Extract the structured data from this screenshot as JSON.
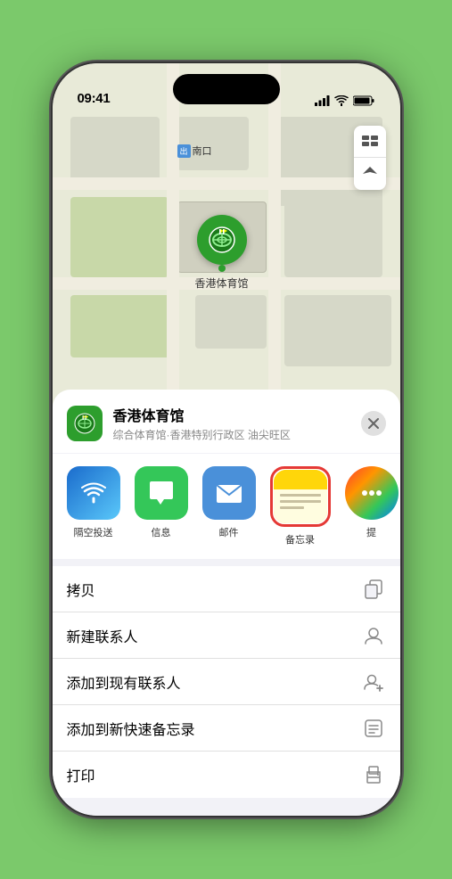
{
  "statusBar": {
    "time": "09:41",
    "location_icon": "arrow-up-right"
  },
  "map": {
    "label_nankou": "南口",
    "label_nankou_prefix": "出",
    "stadium_name": "香港体育馆",
    "pin_label": "香港体育馆"
  },
  "sheet": {
    "venue_name": "香港体育馆",
    "venue_sub": "综合体育馆·香港特别行政区 油尖旺区",
    "close_label": "×"
  },
  "shareRow": {
    "items": [
      {
        "id": "airdrop",
        "label": "隔空投送",
        "type": "airdrop"
      },
      {
        "id": "message",
        "label": "信息",
        "type": "message"
      },
      {
        "id": "mail",
        "label": "邮件",
        "type": "mail"
      },
      {
        "id": "notes",
        "label": "备忘录",
        "type": "notes",
        "selected": true
      },
      {
        "id": "more",
        "label": "提",
        "type": "more"
      }
    ]
  },
  "actionList": {
    "items": [
      {
        "id": "copy",
        "label": "拷贝",
        "icon": "copy"
      },
      {
        "id": "new-contact",
        "label": "新建联系人",
        "icon": "person"
      },
      {
        "id": "add-existing",
        "label": "添加到现有联系人",
        "icon": "person-add"
      },
      {
        "id": "add-notes",
        "label": "添加到新快速备忘录",
        "icon": "notes"
      },
      {
        "id": "print",
        "label": "打印",
        "icon": "print"
      }
    ]
  }
}
